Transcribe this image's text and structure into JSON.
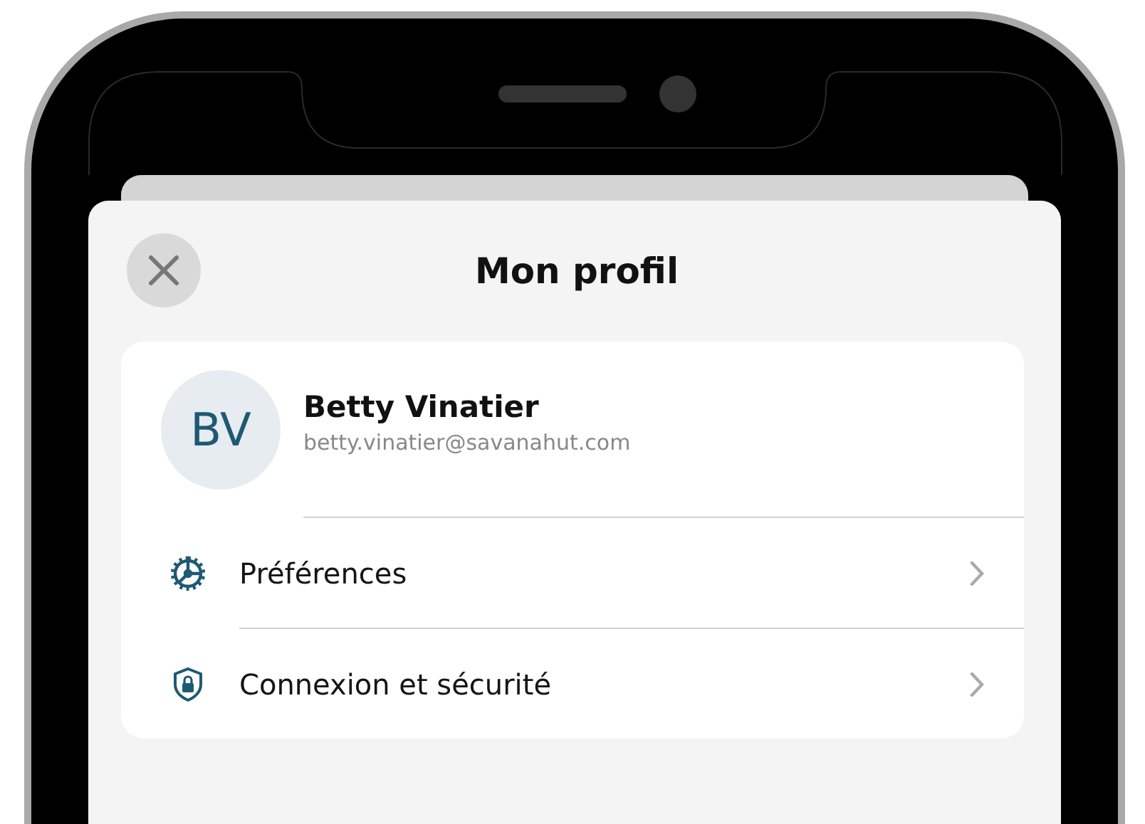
{
  "header": {
    "title": "Mon profil"
  },
  "profile": {
    "initials": "BV",
    "name": "Betty Vinatier",
    "email": "betty.vinatier@savanahut.com"
  },
  "menu": [
    {
      "kind": "preferences",
      "label": "Préférences"
    },
    {
      "kind": "security",
      "label": "Connexion et sécurité"
    }
  ]
}
